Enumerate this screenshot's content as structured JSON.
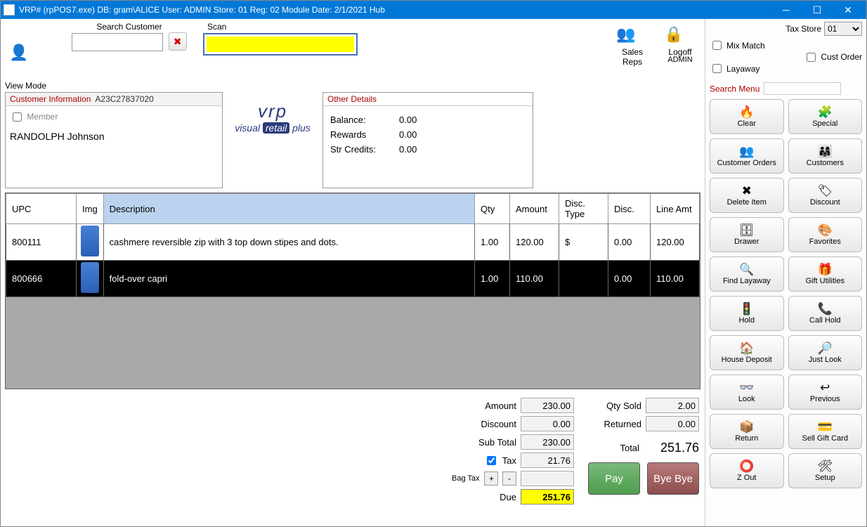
{
  "window": {
    "title": "VRP# (rpPOS7.exe) DB: gram\\ALICE  User: ADMIN Store: 01 Reg: 02 Module Date: 2/1/2021  Hub"
  },
  "topbar": {
    "view_mode": "View Mode",
    "search_customer_label": "Search Customer",
    "search_customer_value": "",
    "scan_label": "Scan",
    "scan_value": "",
    "sales_reps": "Sales Reps",
    "logoff": "Logoff",
    "logoff_user": "ADMIN"
  },
  "customer_panel": {
    "header": "Customer Information",
    "cid": "A23C27837020",
    "member_label": "Member",
    "member_checked": false,
    "name": "RANDOLPH Johnson"
  },
  "other_panel": {
    "header": "Other Details",
    "balance_label": "Balance:",
    "balance": "0.00",
    "rewards_label": "Rewards",
    "rewards": "0.00",
    "strcredits_label": "Str Credits:",
    "strcredits": "0.00"
  },
  "grid": {
    "headers": {
      "upc": "UPC",
      "img": "Img",
      "desc": "Description",
      "qty": "Qty",
      "amount": "Amount",
      "disc_type": "Disc. Type",
      "disc": "Disc.",
      "line_amt": "Line Amt"
    },
    "rows": [
      {
        "upc": "800111",
        "desc": "cashmere reversible zip with 3 top down stipes and dots.",
        "qty": "1.00",
        "amount": "120.00",
        "disc_type": "$",
        "disc": "0.00",
        "line_amt": "120.00",
        "selected": false
      },
      {
        "upc": "800666",
        "desc": "fold-over capri",
        "qty": "1.00",
        "amount": "110.00",
        "disc_type": "",
        "disc": "0.00",
        "line_amt": "110.00",
        "selected": true
      }
    ]
  },
  "totals": {
    "amount_label": "Amount",
    "amount": "230.00",
    "discount_label": "Discount",
    "discount": "0.00",
    "subtotal_label": "Sub Total",
    "subtotal": "230.00",
    "tax_label": "Tax",
    "tax_checked": true,
    "tax": "21.76",
    "bag_tax_label": "Bag Tax",
    "bag_tax": "",
    "due_label": "Due",
    "due": "251.76",
    "qty_sold_label": "Qty Sold",
    "qty_sold": "2.00",
    "returned_label": "Returned",
    "returned": "0.00",
    "total_label": "Total",
    "total": "251.76",
    "pay_label": "Pay",
    "bye_label": "Bye Bye"
  },
  "rightpane": {
    "tax_store_label": "Tax Store",
    "tax_store_value": "01",
    "mix_match": "Mix Match",
    "layaway": "Layaway",
    "cust_order": "Cust Order",
    "search_menu": "Search Menu",
    "buttons": [
      {
        "icon": "🔥",
        "label": "Clear"
      },
      {
        "icon": "🧩",
        "label": "Special"
      },
      {
        "icon": "👥",
        "label": "Customer Orders"
      },
      {
        "icon": "👨‍👩‍👧",
        "label": "Customers"
      },
      {
        "icon": "✖",
        "label": "Delete Item"
      },
      {
        "icon": "🏷",
        "label": "Discount"
      },
      {
        "icon": "🗄",
        "label": "Drawer"
      },
      {
        "icon": "🎨",
        "label": "Favorites"
      },
      {
        "icon": "🔍",
        "label": "Find Layaway"
      },
      {
        "icon": "🎁",
        "label": "Gift Utilities"
      },
      {
        "icon": "🚦",
        "label": "Hold"
      },
      {
        "icon": "📞",
        "label": "Call Hold"
      },
      {
        "icon": "🏠",
        "label": "House Deposit"
      },
      {
        "icon": "🔎",
        "label": "Just Look"
      },
      {
        "icon": "👓",
        "label": "Look"
      },
      {
        "icon": "↩",
        "label": "Previous"
      },
      {
        "icon": "📦",
        "label": "Return"
      },
      {
        "icon": "💳",
        "label": "Sell Gift Card"
      },
      {
        "icon": "⭕",
        "label": "Z Out"
      },
      {
        "icon": "🛠",
        "label": "Setup"
      }
    ]
  }
}
